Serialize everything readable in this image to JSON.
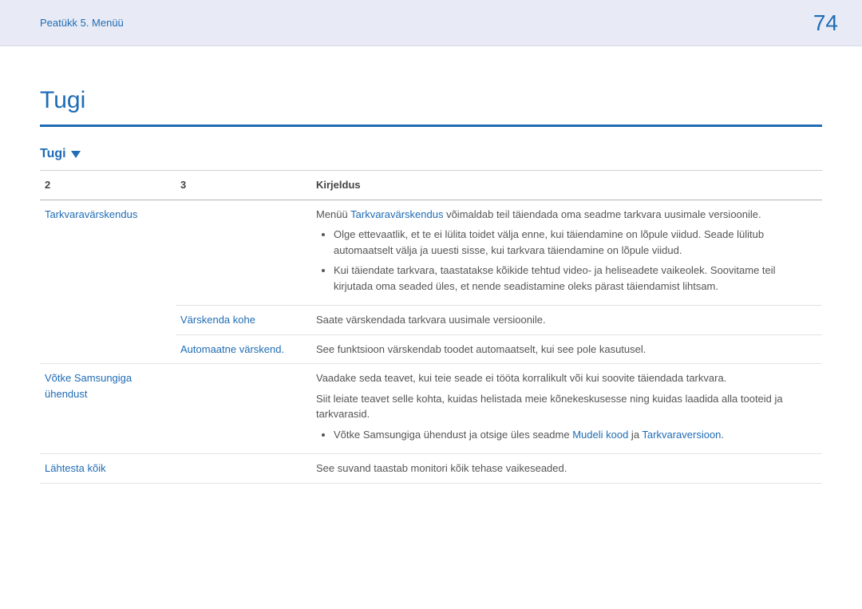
{
  "header": {
    "breadcrumb": "Peatükk 5. Menüü",
    "page_number": "74"
  },
  "title": "Tugi",
  "section_label": "Tugi",
  "columns": {
    "c2": "2",
    "c3": "3",
    "desc": "Kirjeldus"
  },
  "rows": {
    "r1": {
      "c2": "Tarkvaravärskendus",
      "desc_pre": "Menüü ",
      "desc_kw": "Tarkvaravärskendus",
      "desc_post": " võimaldab teil täiendada oma seadme tarkvara uusimale versioonile.",
      "b1": "Olge ettevaatlik, et te ei lülita toidet välja enne, kui täiendamine on lõpule viidud. Seade lülitub automaatselt välja ja uuesti sisse, kui tarkvara täiendamine on lõpule viidud.",
      "b2": "Kui täiendate tarkvara, taastatakse kõikide tehtud video- ja heliseadete vaikeolek. Soovitame teil kirjutada oma seaded üles, et nende seadistamine oleks pärast täiendamist lihtsam."
    },
    "r2": {
      "c3": "Värskenda kohe",
      "desc": "Saate värskendada tarkvara uusimale versioonile."
    },
    "r3": {
      "c3": "Automaatne värskend.",
      "desc": "See funktsioon värskendab toodet automaatselt, kui see pole kasutusel."
    },
    "r4": {
      "c2": "Võtke Samsungiga ühendust",
      "desc1": "Vaadake seda teavet, kui teie seade ei tööta korralikult või kui soovite täiendada tarkvara.",
      "desc2": "Siit leiate teavet selle kohta, kuidas helistada meie kõnekeskusesse ning kuidas laadida alla tooteid ja tarkvarasid.",
      "b1_pre": "Võtke Samsungiga ühendust ja otsige üles seadme ",
      "b1_kw1": "Mudeli kood",
      "b1_mid": " ja ",
      "b1_kw2": "Tarkvaraversioon",
      "b1_post": "."
    },
    "r5": {
      "c2": "Lähtesta kõik",
      "desc": "See suvand taastab monitori kõik tehase vaikeseaded."
    }
  }
}
